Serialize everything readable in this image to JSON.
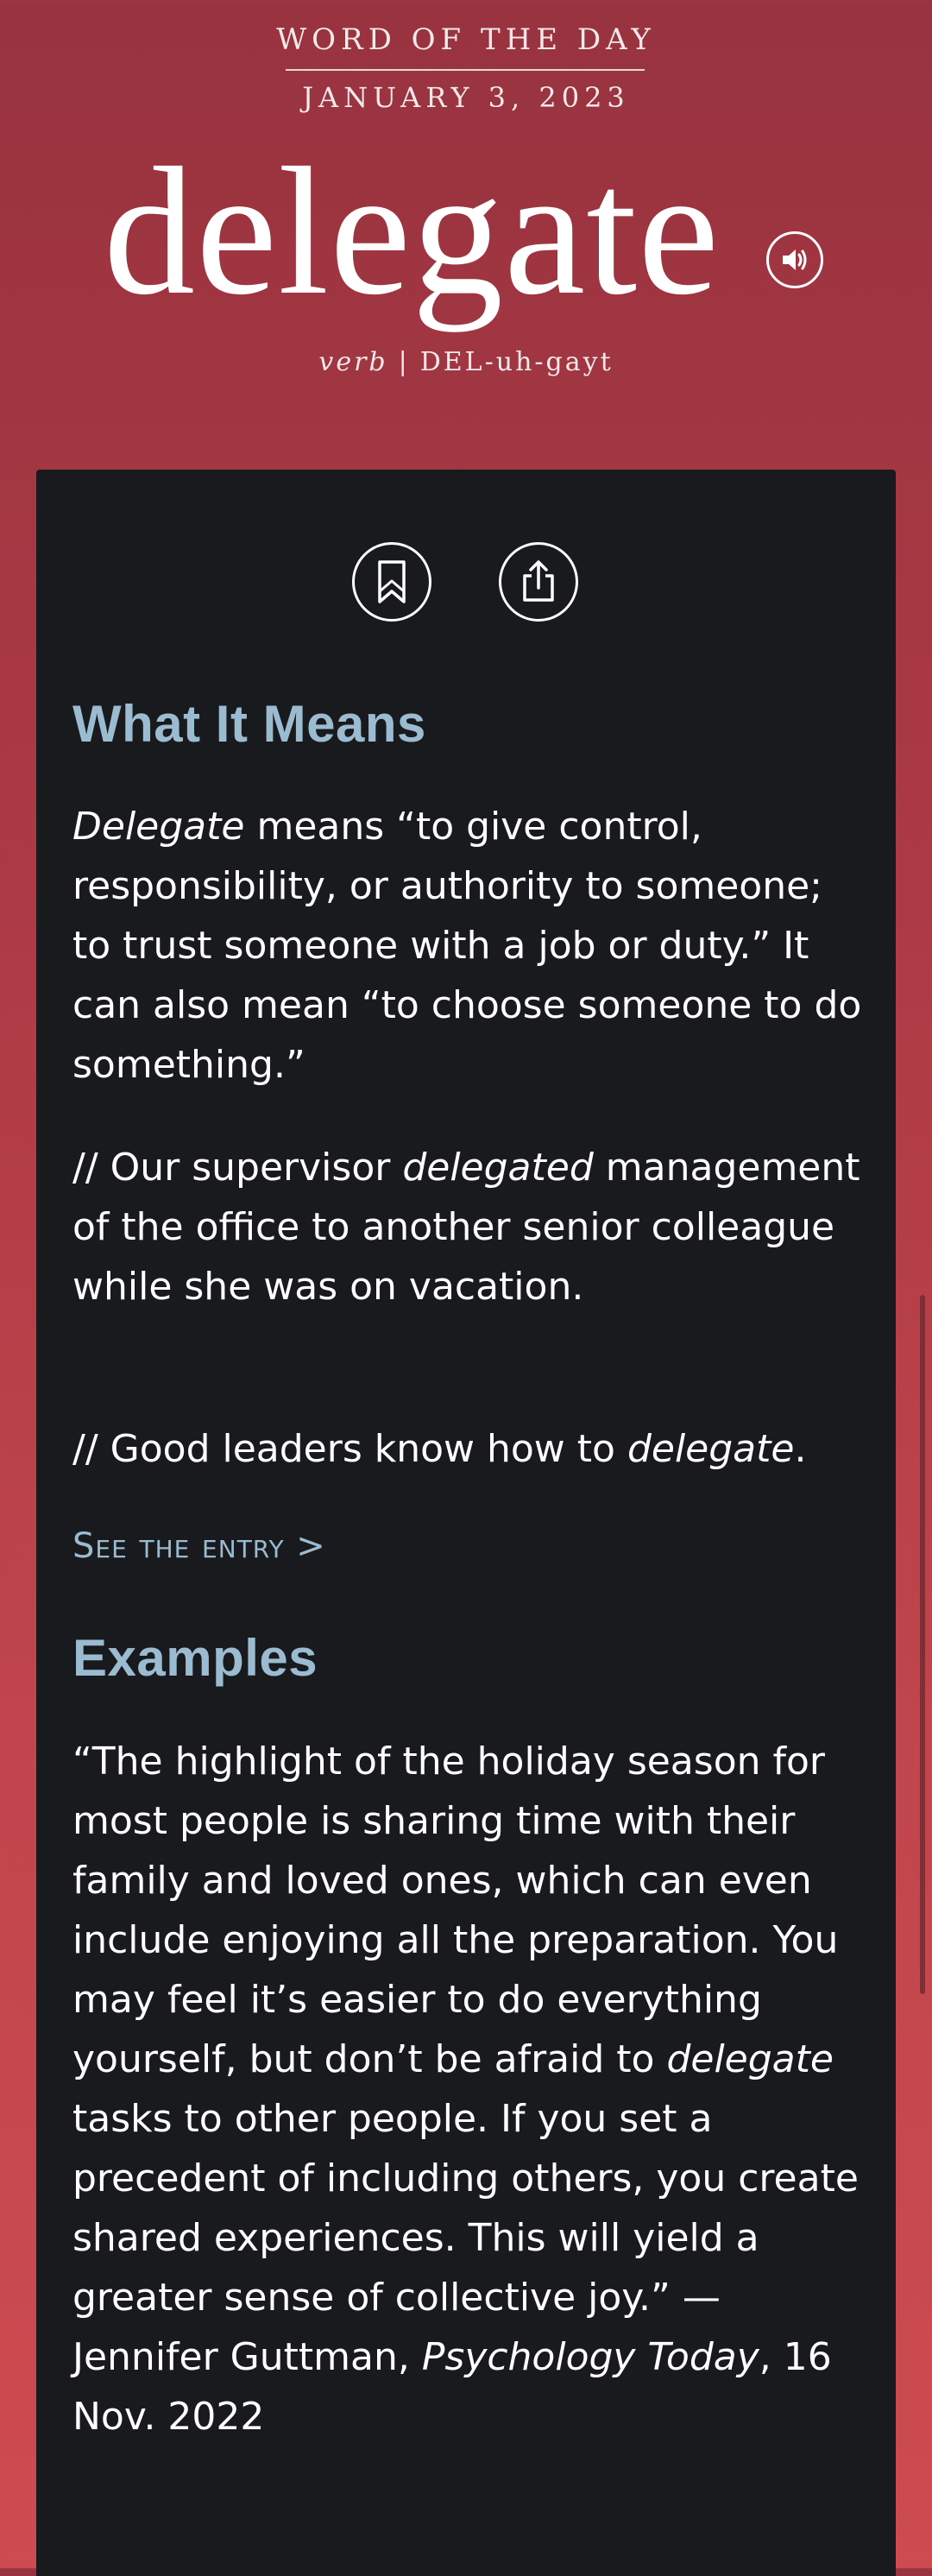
{
  "header": {
    "label": "WORD OF THE DAY",
    "date": "JANUARY 3, 2023",
    "word": "delegate",
    "part_of_speech": "verb",
    "separator": "|",
    "pronunciation": "DEL-uh-gayt"
  },
  "actions": {
    "audio_icon": "speaker-icon",
    "save_icon": "bookmark-icon",
    "share_icon": "share-icon"
  },
  "meaning": {
    "title": "What It Means",
    "def_word": "Delegate",
    "def_text": " means “to give control, responsibility, or authority to someone; to trust someone with a job or duty.” It can also mean “to choose someone to do something.”",
    "ex1_prefix": "// Our supervisor ",
    "ex1_word": "delegated",
    "ex1_suffix": " management of the office to another senior colleague while she was on vacation.",
    "ex2_prefix": "// Good leaders know how to ",
    "ex2_word": "delegate",
    "ex2_suffix": ".",
    "see_entry": "See the entry >"
  },
  "examples": {
    "title": "Examples",
    "quote_part1": "“The highlight of the holiday season for most people is sharing time with their family and loved ones, which can even include enjoying all the preparation. You may feel it’s easier to do everything yourself, but don’t be afraid to ",
    "quote_word": "delegate",
    "quote_part2": " tasks to other people. If you set a precedent of including others, you create shared experiences. This will yield a greater sense of collective joy.” — Jennifer Guttman, ",
    "source": "Psychology Today",
    "date": ", 16 Nov. 2022"
  },
  "colors": {
    "header_gradient_top": "#98333f",
    "header_gradient_bottom": "#cd4b51",
    "card_background": "#191a1d",
    "accent_blue": "#9bbcd0",
    "text_white": "#ffffff"
  }
}
